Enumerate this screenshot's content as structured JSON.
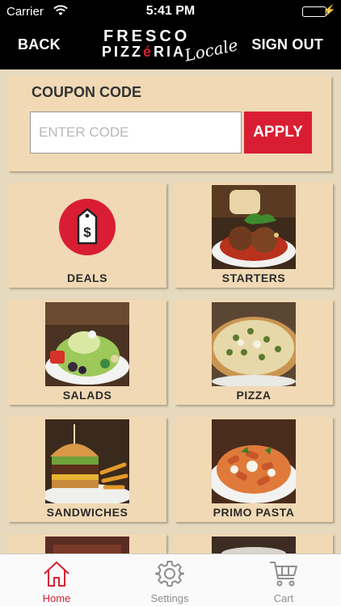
{
  "status_bar": {
    "carrier": "Carrier",
    "time": "5:41 PM"
  },
  "header": {
    "back_label": "BACK",
    "signout_label": "SIGN OUT",
    "logo_line1": "FRESCO",
    "logo_line2_a": "PIZZ",
    "logo_line2_accent": "é",
    "logo_line2_b": "RIA",
    "logo_script": "Locale"
  },
  "coupon": {
    "title": "COUPON CODE",
    "placeholder": "ENTER CODE",
    "value": "",
    "apply_label": "APPLY"
  },
  "menu": {
    "tiles": [
      {
        "label": "DEALS",
        "icon": "price-tag-icon"
      },
      {
        "label": "STARTERS"
      },
      {
        "label": "SALADS"
      },
      {
        "label": "PIZZA"
      },
      {
        "label": "SANDWICHES"
      },
      {
        "label": "PRIMO PASTA"
      }
    ]
  },
  "tabbar": {
    "items": [
      {
        "label": "Home",
        "icon": "home-icon",
        "active": true
      },
      {
        "label": "Settings",
        "icon": "gear-icon",
        "active": false
      },
      {
        "label": "Cart",
        "icon": "cart-icon",
        "active": false
      }
    ]
  },
  "colors": {
    "accent": "#d91e33",
    "tile_bg": "#f0d9b4",
    "page_bg": "#e7d9bd",
    "header_bg": "#000000"
  }
}
